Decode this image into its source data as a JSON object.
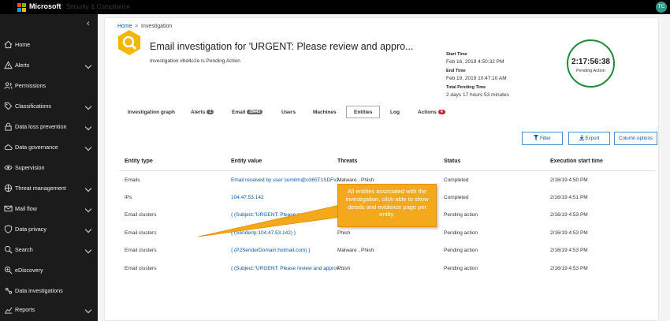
{
  "topbar": {
    "brand": "Microsoft",
    "app_name": "Security & Compliance",
    "avatar_initials": "TC"
  },
  "sidebar": {
    "items": [
      {
        "label": "Home",
        "icon": "home-icon",
        "expandable": false
      },
      {
        "label": "Alerts",
        "icon": "alert-icon",
        "expandable": true
      },
      {
        "label": "Permissions",
        "icon": "people-icon",
        "expandable": false
      },
      {
        "label": "Classifications",
        "icon": "tag-icon",
        "expandable": true
      },
      {
        "label": "Data loss prevention",
        "icon": "lock-icon",
        "expandable": true
      },
      {
        "label": "Data governance",
        "icon": "cloud-icon",
        "expandable": true
      },
      {
        "label": "Supervision",
        "icon": "eye-icon",
        "expandable": false
      },
      {
        "label": "Threat management",
        "icon": "threat-icon",
        "expandable": true
      },
      {
        "label": "Mail flow",
        "icon": "mail-icon",
        "expandable": true
      },
      {
        "label": "Data privacy",
        "icon": "privacy-icon",
        "expandable": true
      },
      {
        "label": "Search",
        "icon": "search-icon",
        "expandable": true
      },
      {
        "label": "eDiscovery",
        "icon": "discovery-icon",
        "expandable": false
      },
      {
        "label": "Data investigations",
        "icon": "investigation-icon",
        "expandable": false
      },
      {
        "label": "Reports",
        "icon": "reports-icon",
        "expandable": true
      }
    ]
  },
  "breadcrumb": {
    "home": "Home",
    "separator": ">",
    "current": "Investigation"
  },
  "header": {
    "title": "Email investigation for 'URGENT: Please review and appro...",
    "subtitle": "Investigation #bd4c2e is Pending Action"
  },
  "meta": {
    "start_time_label": "Start Time",
    "start_time": "Feb 16, 2019 4:50:32 PM",
    "end_time_label": "End Time",
    "end_time": "Feb 19, 2019 10:47:10 AM",
    "total_pending_label": "Total Pending Time",
    "total_pending": "2 days 17 hours 53 minutes"
  },
  "timer": {
    "value": "2:17:56:38",
    "label": "Pending Action",
    "color": "#1f8a3a"
  },
  "tabs": [
    {
      "label": "Investigation graph",
      "badge": ""
    },
    {
      "label": "Alerts",
      "badge": "1"
    },
    {
      "label": "Email",
      "badge": "29443"
    },
    {
      "label": "Users",
      "badge": ""
    },
    {
      "label": "Machines",
      "badge": ""
    },
    {
      "label": "Entities",
      "badge": "",
      "active": true
    },
    {
      "label": "Log",
      "badge": ""
    },
    {
      "label": "Actions",
      "badge": "4"
    }
  ],
  "toolbar": {
    "filter": "Filter",
    "export": "Export",
    "columns": "Column options"
  },
  "table": {
    "headers": [
      "Entity type",
      "Entity value",
      "Threats",
      "Status",
      "Execution start time"
    ],
    "rows": [
      [
        "Emails",
        "Email received by user sumitm@o365T1SDFv2...",
        "Malware , Phish",
        "Completed",
        "2/16/19 4:50 PM"
      ],
      [
        "IPs",
        "104.47.53.142",
        "",
        "Completed",
        "2/16/19 4:51 PM"
      ],
      [
        "Email clusters",
        "{ (Subject:\"URGENT: Please review and approv...",
        "",
        "Pending action",
        "2/16/19 4:53 PM"
      ],
      [
        "Email clusters",
        "{ (SenderIp:104.47.53.142) }",
        "Phish",
        "Pending action",
        "2/16/19 4:53 PM"
      ],
      [
        "Email clusters",
        "{ (P2SenderDomain:hotmail.com) }",
        "Malware , Phish",
        "Pending action",
        "2/16/19 4:53 PM"
      ],
      [
        "Email clusters",
        "{ (Subject:\"URGENT: Please review and approv...",
        "Phish",
        "Pending action",
        "2/16/19 4:53 PM"
      ]
    ]
  },
  "callout": {
    "text": "All entities associated with the investigation, click-able to show details and evidence page per entity.",
    "color": "#f4a91c"
  }
}
